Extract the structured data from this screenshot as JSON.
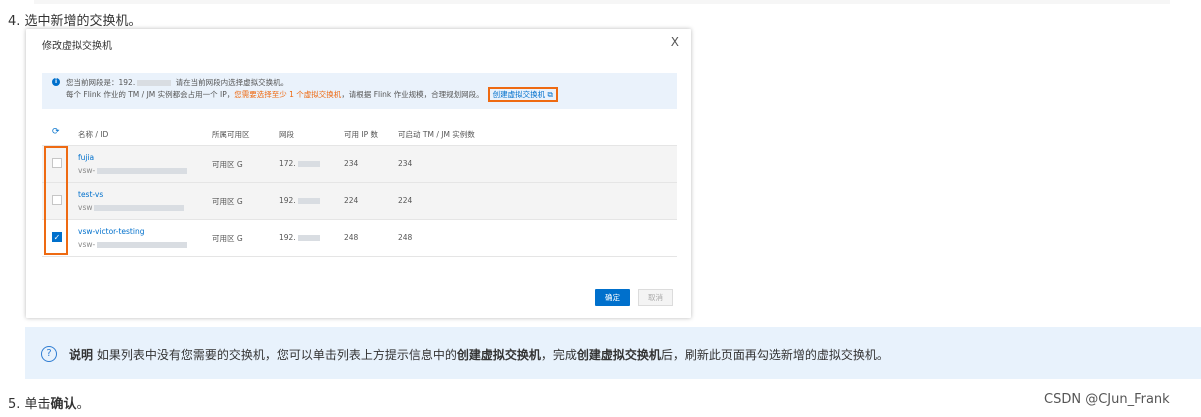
{
  "step4": "4. 选中新增的交换机。",
  "dialog": {
    "title": "修改虚拟交换机",
    "close": "X",
    "info_line1_prefix": "您当前网段是：192.",
    "info_line1_suffix": "请在当前网段内选择虚拟交换机。",
    "info_line2_prefix": "每个 Flink 作业的 TM / JM 实例都会占用一个 IP，",
    "info_line2_warn": "您需要选择至少 1 个虚拟交换机",
    "info_line2_mid": "，请根据 Flink 作业规模，合理规划网段。",
    "info_link": "创建虚拟交换机 ⧉",
    "columns": [
      "名称 / ID",
      "所属可用区",
      "网段",
      "可用 IP 数",
      "可启动 TM / JM 实例数"
    ],
    "rows": [
      {
        "name": "fujia",
        "vsw": "vsw-",
        "zone": "可用区 G",
        "seg": "172.",
        "ips": "234",
        "cnt": "234",
        "checked": false
      },
      {
        "name": "test-vs",
        "vsw": "vsw",
        "zone": "可用区 G",
        "seg": "192.",
        "ips": "224",
        "cnt": "224",
        "checked": false
      },
      {
        "name": "vsw-victor-testing",
        "vsw": "vsw-",
        "zone": "可用区 G",
        "seg": "192.",
        "ips": "248",
        "cnt": "248",
        "checked": true
      }
    ],
    "ok": "确定",
    "cancel": "取消"
  },
  "note": {
    "label": "说明",
    "t1": " 如果列表中没有您需要的交换机，您可以单击列表上方提示信息中的",
    "b1": "创建虚拟交换机",
    "t2": "，完成",
    "b2": "创建虚拟交换机",
    "t3": "后，刷新此页面再勾选新增的虚拟交换机。"
  },
  "step5_prefix": "5. 单击",
  "step5_bold": "确认",
  "step5_suffix": "。",
  "watermark": "CSDN @CJun_Frank",
  "colors": {
    "accent": "#0070cc",
    "highlight": "#ee6a12",
    "note_bg": "#e8f2fc"
  }
}
